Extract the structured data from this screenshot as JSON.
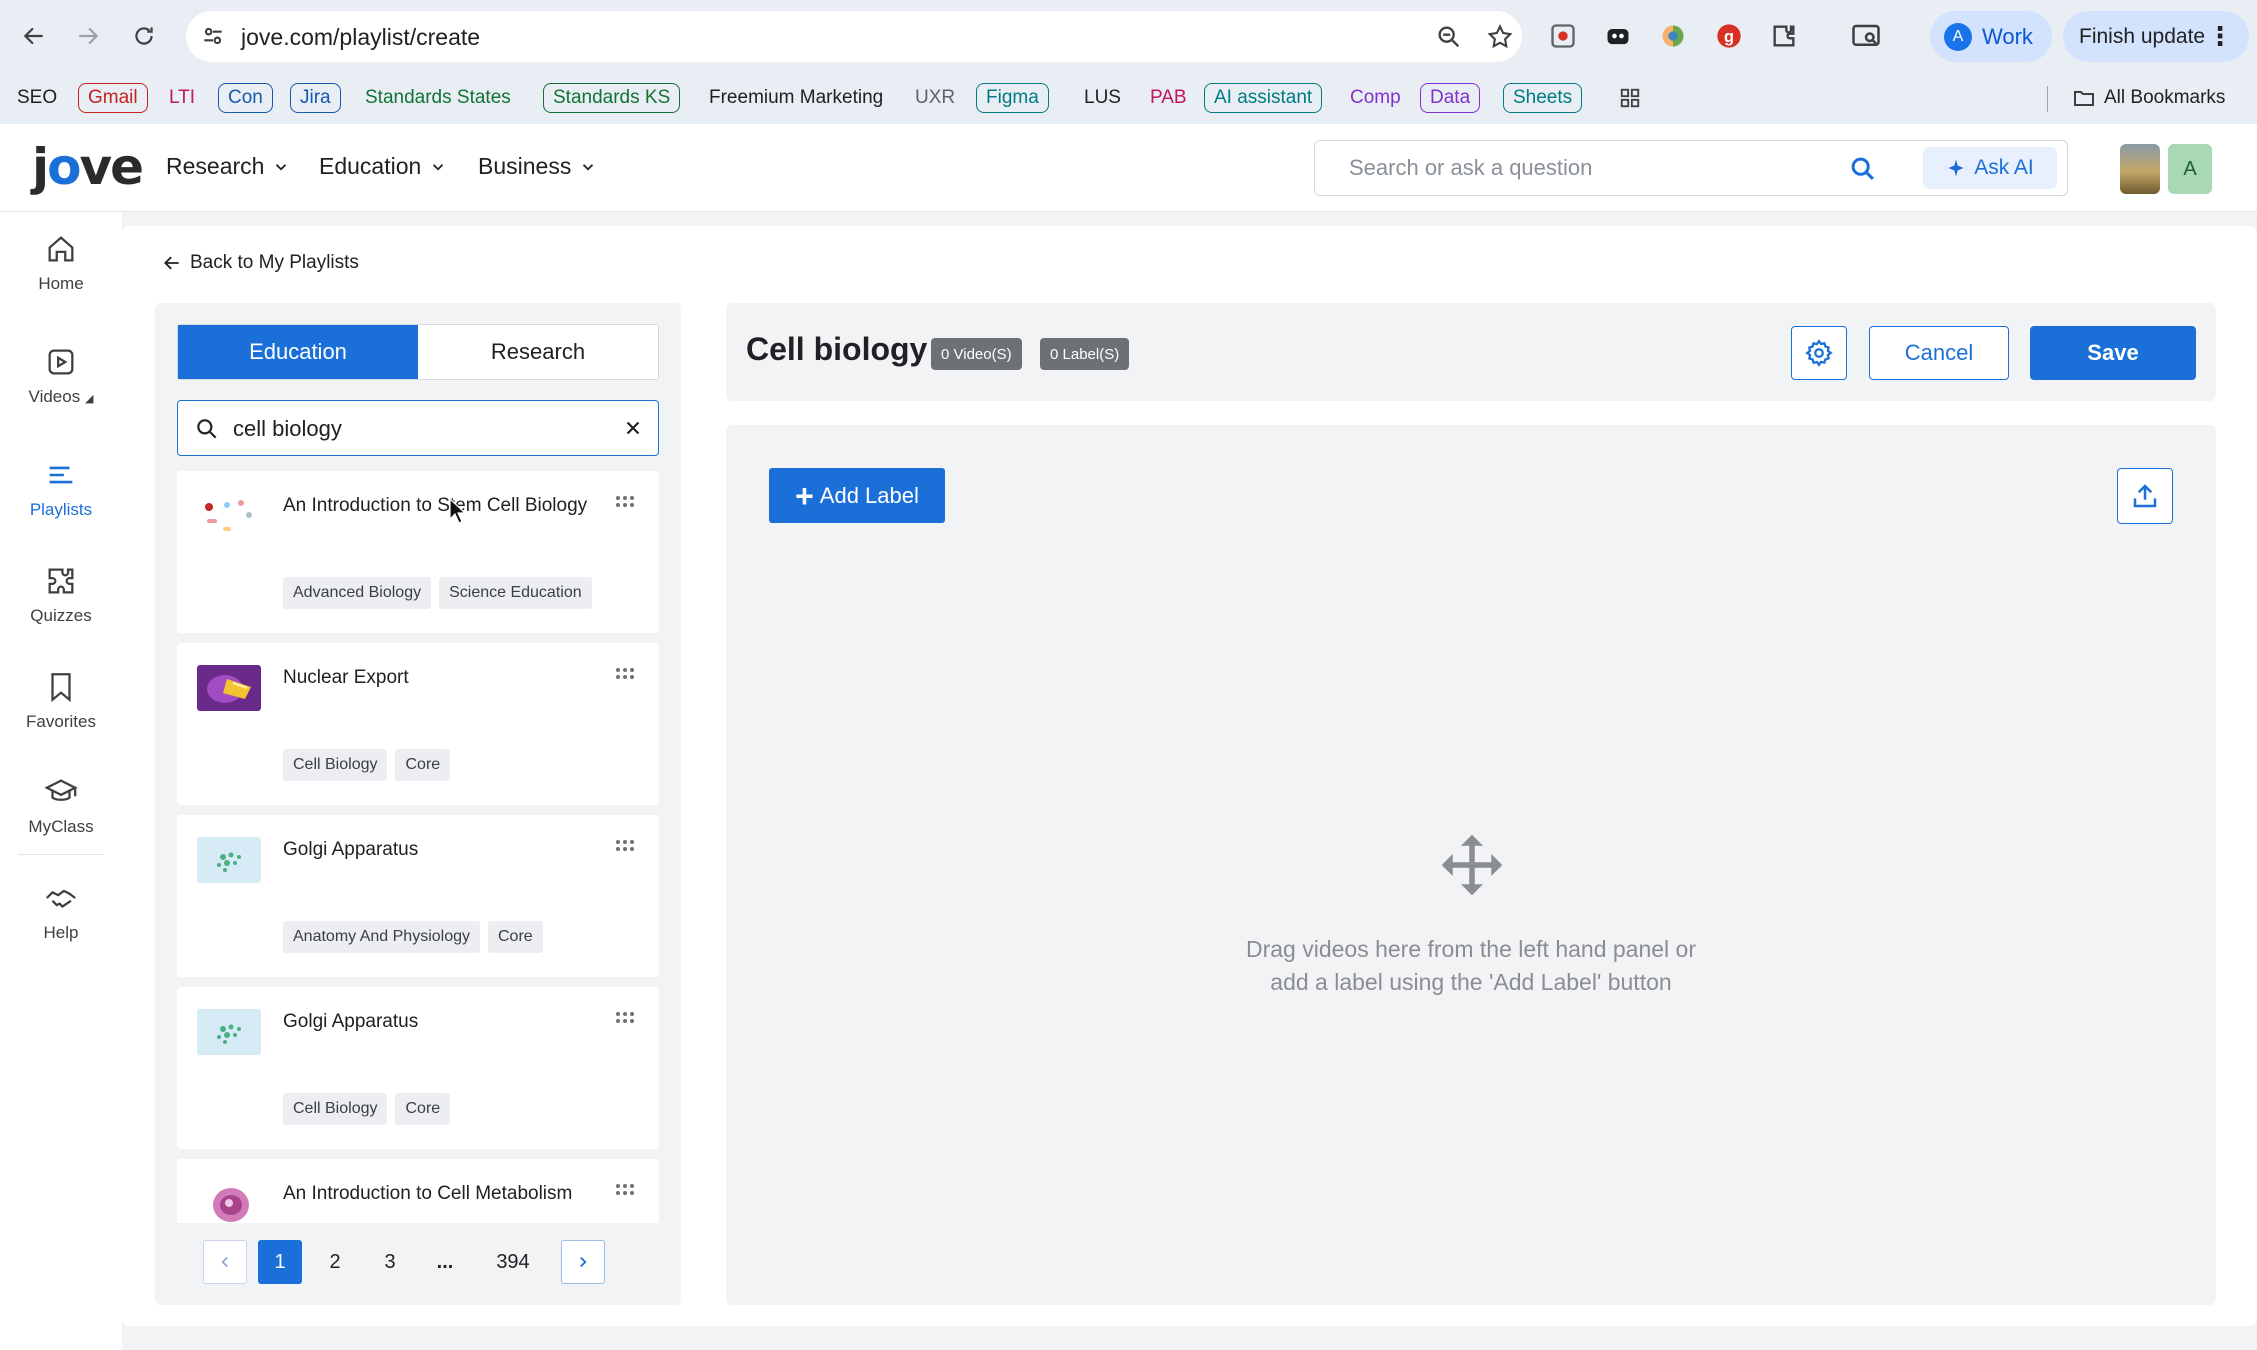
{
  "browser": {
    "url": "jove.com/playlist/create",
    "profile_label": "Work",
    "profile_initial": "A",
    "update_label": "Finish update",
    "bookmarks": [
      {
        "label": "SEO",
        "color": "#202124",
        "border": "none"
      },
      {
        "label": "Gmail",
        "color": "#c5221f",
        "border": "#c5221f"
      },
      {
        "label": "LTI",
        "color": "#c2185b",
        "border": "none"
      },
      {
        "label": "Con",
        "color": "#1558b0",
        "border": "#1558b0"
      },
      {
        "label": "Jira",
        "color": "#1558b0",
        "border": "#1558b0"
      },
      {
        "label": "Standards States",
        "color": "#137333",
        "border": "none"
      },
      {
        "label": "Standards KS",
        "color": "#137333",
        "border": "#137333"
      },
      {
        "label": "Freemium Marketing",
        "color": "#202124",
        "border": "none"
      },
      {
        "label": "UXR",
        "color": "#5f6368",
        "border": "none"
      },
      {
        "label": "Figma",
        "color": "#007b83",
        "border": "#007b83"
      },
      {
        "label": "LUS",
        "color": "#202124",
        "border": "none"
      },
      {
        "label": "PAB",
        "color": "#c2185b",
        "border": "none"
      },
      {
        "label": "AI assistant",
        "color": "#007b83",
        "border": "#007b83"
      },
      {
        "label": "Comp",
        "color": "#8430ce",
        "border": "none"
      },
      {
        "label": "Data",
        "color": "#8430ce",
        "border": "#8430ce"
      },
      {
        "label": "Sheets",
        "color": "#007b83",
        "border": "#007b83"
      }
    ],
    "all_bookmarks_label": "All Bookmarks"
  },
  "header": {
    "logo": "jove",
    "nav": [
      {
        "label": "Research"
      },
      {
        "label": "Education"
      },
      {
        "label": "Business"
      }
    ],
    "search_placeholder": "Search or ask a question",
    "ask_ai_label": "Ask AI",
    "avatar_initial": "A"
  },
  "rail": {
    "items": [
      {
        "label": "Home",
        "icon": "home-icon"
      },
      {
        "label": "Videos",
        "icon": "video-icon"
      },
      {
        "label": "Playlists",
        "icon": "playlist-icon"
      },
      {
        "label": "Quizzes",
        "icon": "puzzle-icon"
      },
      {
        "label": "Favorites",
        "icon": "bookmark-icon"
      },
      {
        "label": "MyClass",
        "icon": "graduation-cap-icon"
      },
      {
        "label": "Help",
        "icon": "handshake-icon"
      }
    ],
    "active": "Playlists"
  },
  "back_link": "Back to My Playlists",
  "left_panel": {
    "tabs": [
      "Education",
      "Research"
    ],
    "active_tab": "Education",
    "search_value": "cell biology",
    "videos": [
      {
        "title": "An Introduction to Stem Cell Biology",
        "tags": [
          "Advanced Biology",
          "Science Education"
        ]
      },
      {
        "title": "Nuclear Export",
        "tags": [
          "Cell Biology",
          "Core"
        ]
      },
      {
        "title": "Golgi Apparatus",
        "tags": [
          "Anatomy And Physiology",
          "Core"
        ]
      },
      {
        "title": "Golgi Apparatus",
        "tags": [
          "Cell Biology",
          "Core"
        ]
      },
      {
        "title": "An Introduction to Cell Metabolism",
        "tags": []
      }
    ],
    "pagination": {
      "pages": [
        "1",
        "2",
        "3",
        "...",
        "394"
      ],
      "current": "1"
    }
  },
  "playlist": {
    "title": "Cell biology",
    "video_count": "0 Video(S)",
    "label_count": "0 Label(S)",
    "cancel_label": "Cancel",
    "save_label": "Save",
    "add_label": "Add Label",
    "empty_line1": "Drag videos here from the left hand panel or",
    "empty_line2": "add a label using the 'Add Label' button"
  },
  "colors": {
    "brand": "#1b6fd9",
    "panel_bg": "#f2f3f5",
    "badge": "#6d7176"
  }
}
